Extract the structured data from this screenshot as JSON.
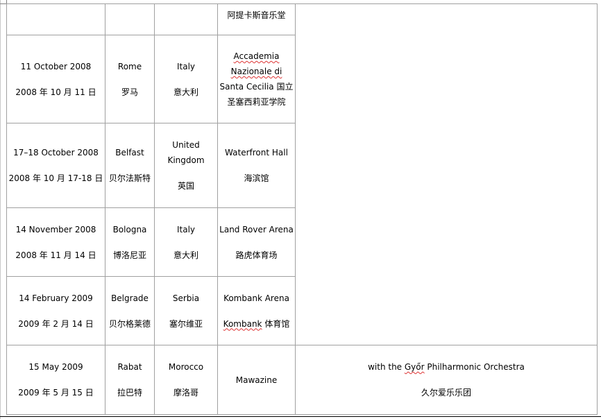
{
  "rows": [
    {
      "date_en": "",
      "date_zh": "",
      "city_en": "",
      "city_zh": "",
      "country_en": "",
      "country_zh": "",
      "venue_en": "",
      "venue_zh": "阿提卡斯音乐堂",
      "notes_en": "",
      "notes_zh": ""
    },
    {
      "date_en": "11 October 2008",
      "date_zh": "2008 年 10 月 11 日",
      "city_en": "Rome",
      "city_zh": "罗马",
      "country_en": "Italy",
      "country_zh": "意大利",
      "venue_en": "Accademia Nazionale di Santa Cecilia",
      "venue_en_parts": [
        "Accademia",
        " ",
        "Nazionale di",
        " Santa Cecilia "
      ],
      "venue_zh": "国立圣塞西莉亚学院",
      "notes_en": "",
      "notes_zh": ""
    },
    {
      "date_en": "17–18 October 2008",
      "date_zh": "2008 年 10 月 17-18 日",
      "city_en": "Belfast",
      "city_zh": "贝尔法斯特",
      "country_en": "United Kingdom",
      "country_zh": "英国",
      "venue_en": "Waterfront Hall",
      "venue_zh": "海滨馆",
      "notes_en": "",
      "notes_zh": ""
    },
    {
      "date_en": "14 November 2008",
      "date_zh": "2008 年 11 月 14 日",
      "city_en": "Bologna",
      "city_zh": "博洛尼亚",
      "country_en": "Italy",
      "country_zh": "意大利",
      "venue_en": "Land Rover Arena",
      "venue_zh": "路虎体育场",
      "notes_en": "",
      "notes_zh": ""
    },
    {
      "date_en": "14 February 2009",
      "date_zh": "2009 年 2 月 14 日",
      "city_en": "Belgrade",
      "city_zh": "贝尔格莱德",
      "country_en": "Serbia",
      "country_zh": "塞尔维亚",
      "venue_en": "Kombank Arena",
      "venue_zh": "Kombank 体育馆",
      "venue_zh_parts": [
        "Kombank",
        " 体育馆"
      ],
      "notes_en": "",
      "notes_zh": ""
    },
    {
      "date_en": "15 May 2009",
      "date_zh": "2009 年 5 月 15 日",
      "city_en": "Rabat",
      "city_zh": "拉巴特",
      "country_en": "Morocco",
      "country_zh": "摩洛哥",
      "venue_en": "Mawazine",
      "venue_zh": "",
      "notes_en": "with the Győr Philharmonic Orchestra",
      "notes_en_parts": [
        "with the ",
        "Győr",
        " Philharmonic Orchestra"
      ],
      "notes_zh": "久尔爱乐乐团"
    }
  ]
}
